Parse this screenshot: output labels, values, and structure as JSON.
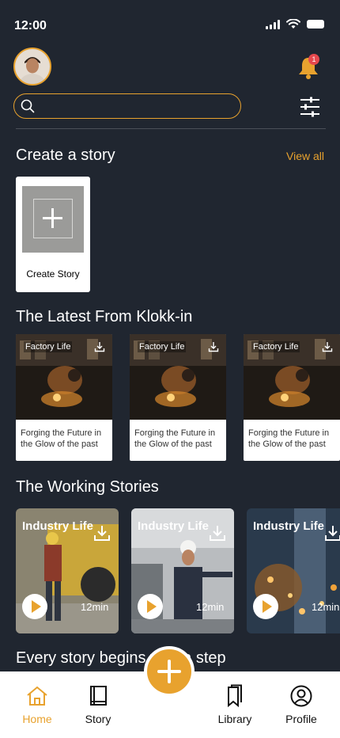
{
  "status": {
    "time": "12:00"
  },
  "header": {
    "notification_count": "1"
  },
  "search": {
    "placeholder": ""
  },
  "create_section": {
    "title": "Create a story",
    "view_all": "View all",
    "card_label": "Create Story"
  },
  "latest_section": {
    "title": "The Latest From Klokk-in",
    "cards": [
      {
        "tag": "Factory Life",
        "caption": "Forging the Future in the Glow of the past"
      },
      {
        "tag": "Factory Life",
        "caption": "Forging the Future in the Glow of the past"
      },
      {
        "tag": "Factory Life",
        "caption": "Forging the Future in the Glow of the past"
      }
    ]
  },
  "working_section": {
    "title": "The Working Stories",
    "cards": [
      {
        "tag": "Industry Life",
        "duration": "12min"
      },
      {
        "tag": "Industry Life",
        "duration": "12min"
      },
      {
        "tag": "Industry Life",
        "duration": "12min"
      }
    ]
  },
  "next_section": {
    "title": "Every story begins with a step"
  },
  "nav": {
    "items": [
      {
        "label": "Home",
        "icon": "home-icon",
        "active": true
      },
      {
        "label": "Story",
        "icon": "book-icon",
        "active": false
      },
      {
        "label": "Library",
        "icon": "bookmarks-icon",
        "active": false
      },
      {
        "label": "Profile",
        "icon": "user-circle-icon",
        "active": false
      }
    ]
  },
  "colors": {
    "background": "#202630",
    "accent": "#e8a22e",
    "badge": "#e5484d"
  }
}
